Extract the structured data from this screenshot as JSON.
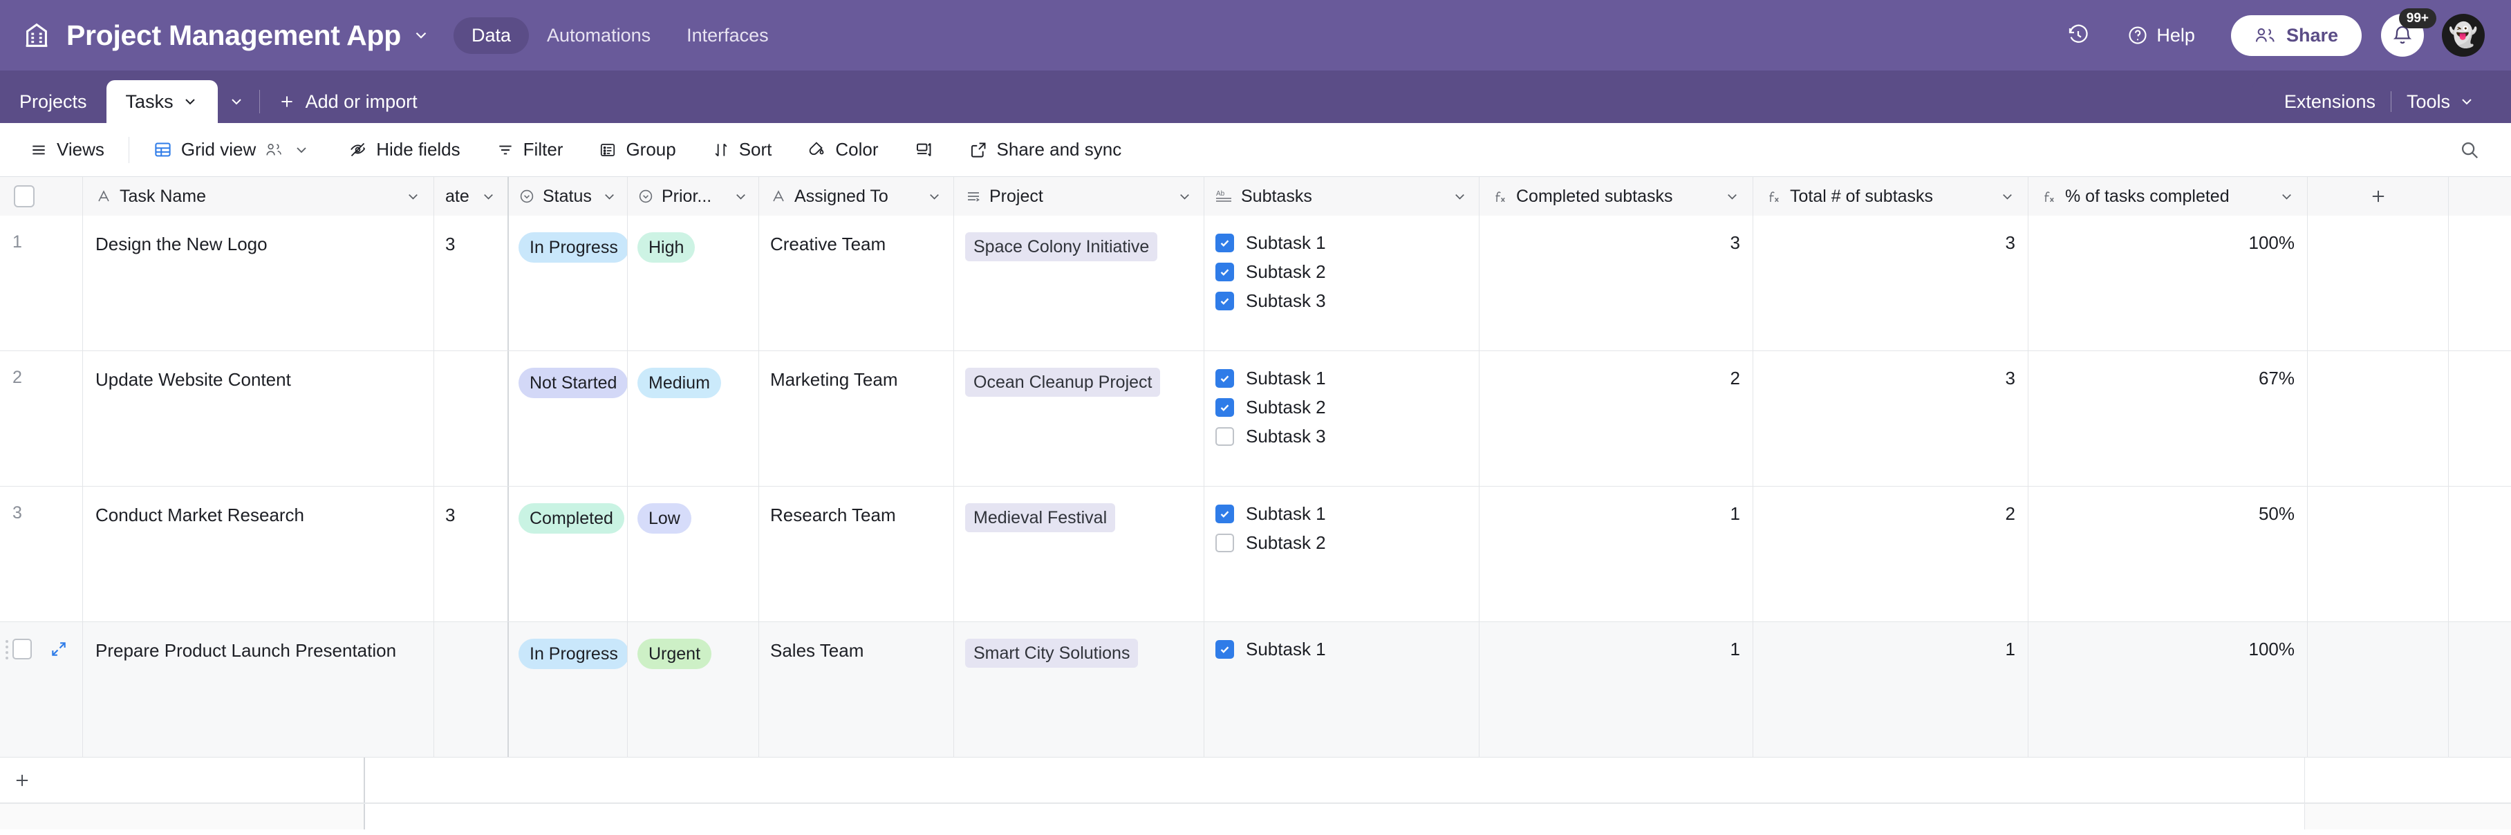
{
  "header": {
    "app_title": "Project Management App",
    "app_icon": "bank-building-icon",
    "nav": [
      {
        "label": "Data",
        "active": true
      },
      {
        "label": "Automations",
        "active": false
      },
      {
        "label": "Interfaces",
        "active": false
      }
    ],
    "history_icon": "history-clock-icon",
    "help_label": "Help",
    "share_label": "Share",
    "notifications_badge": "99+",
    "avatar_glyph": "👻"
  },
  "tabs": {
    "items": [
      {
        "label": "Projects",
        "active": false,
        "caret": false
      },
      {
        "label": "Tasks",
        "active": true,
        "caret": true
      }
    ],
    "add_or_import": "Add or import",
    "right": [
      {
        "label": "Extensions",
        "caret": false
      },
      {
        "label": "Tools",
        "caret": true
      }
    ]
  },
  "toolbar": {
    "views": "Views",
    "grid_view": "Grid view",
    "hide_fields": "Hide fields",
    "filter": "Filter",
    "group": "Group",
    "sort": "Sort",
    "color": "Color",
    "row_height": "",
    "share_and_sync": "Share and sync",
    "search_icon": "search-icon"
  },
  "grid": {
    "columns": [
      {
        "key": "rownum",
        "label": "",
        "icon": "",
        "class": "rownum-cell",
        "caret": false
      },
      {
        "key": "name",
        "label": "Task Name",
        "icon": "text-A-icon",
        "class": "name-cell",
        "caret": true
      },
      {
        "key": "date",
        "label": "ate",
        "icon": "",
        "class": "date-cell frozen-sep",
        "caret": true
      },
      {
        "key": "status",
        "label": "Status",
        "icon": "single-select-icon",
        "class": "status-cell",
        "caret": true
      },
      {
        "key": "priority",
        "label": "Prior...",
        "icon": "single-select-icon",
        "class": "prio-cell",
        "caret": true
      },
      {
        "key": "assigned",
        "label": "Assigned To",
        "icon": "text-A-icon",
        "class": "assign-cell",
        "caret": true
      },
      {
        "key": "project",
        "label": "Project",
        "icon": "link-record-icon",
        "class": "project-cell",
        "caret": true
      },
      {
        "key": "subtasks",
        "label": "Subtasks",
        "icon": "long-text-icon",
        "class": "subtask-cell",
        "caret": true
      },
      {
        "key": "completed",
        "label": "Completed subtasks",
        "icon": "formula-icon",
        "class": "comp-cell",
        "caret": true
      },
      {
        "key": "total",
        "label": "Total # of subtasks",
        "icon": "formula-icon",
        "class": "total-cell",
        "caret": true
      },
      {
        "key": "pct",
        "label": "% of tasks completed",
        "icon": "formula-icon",
        "class": "pct-cell",
        "caret": true
      }
    ],
    "add_field_icon": "plus-icon",
    "add_row_icon": "plus-icon",
    "rows": [
      {
        "num": "1",
        "name": "Design the New Logo",
        "date": "3",
        "status": "In Progress",
        "status_color": "#c9e7fb",
        "priority": "High",
        "priority_color": "#cdf3e4",
        "assigned": "Creative Team",
        "project": "Space Colony Initiative",
        "subtasks": [
          {
            "label": "Subtask 1",
            "checked": true
          },
          {
            "label": "Subtask 2",
            "checked": true
          },
          {
            "label": "Subtask 3",
            "checked": true
          }
        ],
        "completed": "3",
        "total": "3",
        "pct": "100%",
        "hovered": false
      },
      {
        "num": "2",
        "name": "Update Website Content",
        "date": "",
        "status": "Not Started",
        "status_color": "#d3d8f7",
        "priority": "Medium",
        "priority_color": "#cbeafb",
        "assigned": "Marketing Team",
        "project": "Ocean Cleanup Project",
        "subtasks": [
          {
            "label": "Subtask 1",
            "checked": true
          },
          {
            "label": "Subtask 2",
            "checked": true
          },
          {
            "label": "Subtask 3",
            "checked": false
          }
        ],
        "completed": "2",
        "total": "3",
        "pct": "67%",
        "hovered": false
      },
      {
        "num": "3",
        "name": "Conduct Market Research",
        "date": "3",
        "status": "Completed",
        "status_color": "#c9f3e3",
        "priority": "Low",
        "priority_color": "#d6dcfa",
        "assigned": "Research Team",
        "project": "Medieval Festival",
        "subtasks": [
          {
            "label": "Subtask 1",
            "checked": true
          },
          {
            "label": "Subtask 2",
            "checked": false
          }
        ],
        "completed": "1",
        "total": "2",
        "pct": "50%",
        "hovered": false
      },
      {
        "num": "",
        "name": "Prepare Product Launch Presentation",
        "date": "",
        "status": "In Progress",
        "status_color": "#c9e7fb",
        "priority": "Urgent",
        "priority_color": "#cdf0c6",
        "assigned": "Sales Team",
        "project": "Smart City Solutions",
        "subtasks": [
          {
            "label": "Subtask 1",
            "checked": true
          }
        ],
        "completed": "1",
        "total": "1",
        "pct": "100%",
        "hovered": true
      }
    ]
  },
  "colors": {
    "header_purple": "#695a9a",
    "tabstrip_purple": "#5b4d87",
    "accent_blue": "#2f7ce8"
  }
}
